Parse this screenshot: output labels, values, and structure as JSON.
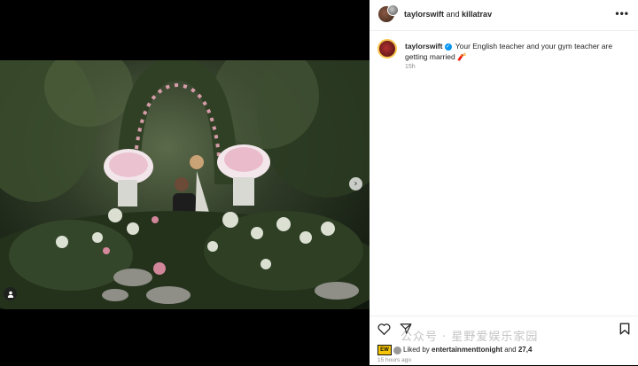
{
  "post": {
    "header_user": "taylorswift",
    "header_and": " and ",
    "header_collab": "killatrav",
    "more_icon": "more-horizontal-icon",
    "caption_user": "taylorswift",
    "caption_text": " Your English teacher and your gym teacher are getting married ",
    "caption_emoji": "🧨",
    "time": "15h",
    "liked_prefix": "Liked by ",
    "liked_by": "entertainmenttonight",
    "liked_and": " and ",
    "liked_count": "27,4",
    "ago": "15 hours ago",
    "badge": "EW"
  },
  "media": {
    "next_arrow": "›",
    "tag_icon": "person-icon",
    "scene": "garden-proposal-photo"
  },
  "watermark": "公众号 · 星野爱娱乐家园",
  "colors": {
    "verified": "#0095f6",
    "avatar_ring": "#f9c74f"
  }
}
